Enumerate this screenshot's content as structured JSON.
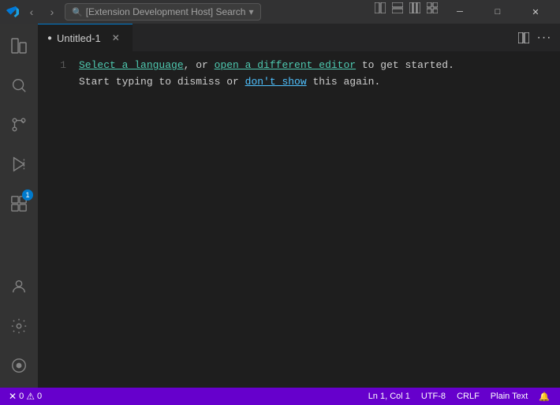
{
  "titleBar": {
    "icon": "⬡",
    "navBack": "‹",
    "navForward": "›",
    "searchPlaceholder": "[Extension Development Host] Search",
    "dropdownIcon": "▾",
    "layoutBtn1": "⬜",
    "layoutBtn2": "⬜",
    "layoutBtn3": "⬜",
    "layoutBtn4": "⬜",
    "minimize": "─",
    "maximize": "□",
    "close": "✕"
  },
  "activityBar": {
    "items": [
      {
        "name": "explorer",
        "icon": "⎘",
        "active": false
      },
      {
        "name": "search",
        "icon": "🔍",
        "active": false
      },
      {
        "name": "source-control",
        "icon": "⑂",
        "active": false
      },
      {
        "name": "run-debug",
        "icon": "▷",
        "active": false
      },
      {
        "name": "extensions",
        "icon": "⊞",
        "active": false,
        "badge": "1"
      }
    ],
    "bottomItems": [
      {
        "name": "account",
        "icon": "👤"
      },
      {
        "name": "settings",
        "icon": "⚙"
      },
      {
        "name": "debug-console",
        "icon": "⊙"
      }
    ]
  },
  "tab": {
    "title": "Untitled-1",
    "dot": "●"
  },
  "editor": {
    "lineNumber": "1",
    "line1Part1": "Select a language",
    "line1Comma": ", or ",
    "line1Part2": "open a different editor",
    "line1Part3": " to get started.",
    "line2Part1": "Start typing to dismiss or ",
    "line2Part2": "don't show",
    "line2Part3": " this again."
  },
  "statusBar": {
    "errorsIcon": "✕",
    "errors": "0",
    "warningsIcon": "⚠",
    "warnings": "0",
    "position": "Ln 1, Col 1",
    "encoding": "UTF-8",
    "lineEnding": "CRLF",
    "language": "Plain Text",
    "bellIcon": "🔔",
    "backgroundColor": "#6600cc"
  }
}
